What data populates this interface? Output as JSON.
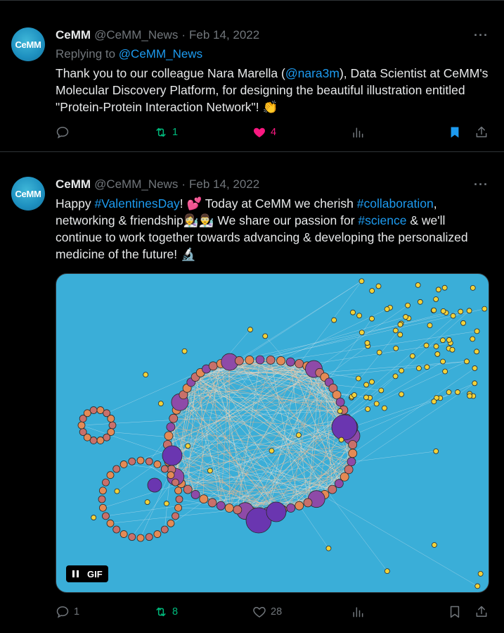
{
  "tweets": [
    {
      "author_name": "CeMM",
      "handle": "@CeMM_News",
      "separator": "·",
      "date": "Feb 14, 2022",
      "avatar_text": "CeMM",
      "more_label": "···",
      "replying_prefix": "Replying to",
      "replying_handle": "@CeMM_News",
      "text_parts": [
        "Thank you to our colleague Nara Marella (",
        "@nara3m",
        "), Data Scientist at CeMM's Molecular Discovery Platform, for designing the beautiful illustration entitled \"Protein-Protein Interaction Network\"! ",
        "👏"
      ],
      "actions": {
        "reply": "",
        "retweet": "1",
        "like": "4",
        "views": ""
      }
    },
    {
      "author_name": "CeMM",
      "handle": "@CeMM_News",
      "separator": "·",
      "date": "Feb 14, 2022",
      "avatar_text": "CeMM",
      "more_label": "···",
      "text_parts": [
        "Happy ",
        "#ValentinesDay",
        "! ",
        "💕",
        " Today at CeMM we cherish ",
        "#collaboration",
        ", networking & friendship",
        "👩‍🔬👨‍🔬",
        " We share our passion for ",
        "#science",
        " & we'll continue to work together towards advancing & developing the personalized medicine of the future! ",
        "🔬"
      ],
      "media": {
        "type": "GIF",
        "badge_label": "GIF"
      },
      "actions": {
        "reply": "1",
        "retweet": "8",
        "like": "28",
        "views": ""
      }
    }
  ],
  "colors": {
    "background": "#000000",
    "text": "#e7e9ea",
    "muted": "#71767b",
    "link": "#1d9bf0",
    "retweet": "#00ba7c",
    "like": "#f91880",
    "bookmark": "#1d9bf0",
    "media_bg": "#3aaed8"
  }
}
